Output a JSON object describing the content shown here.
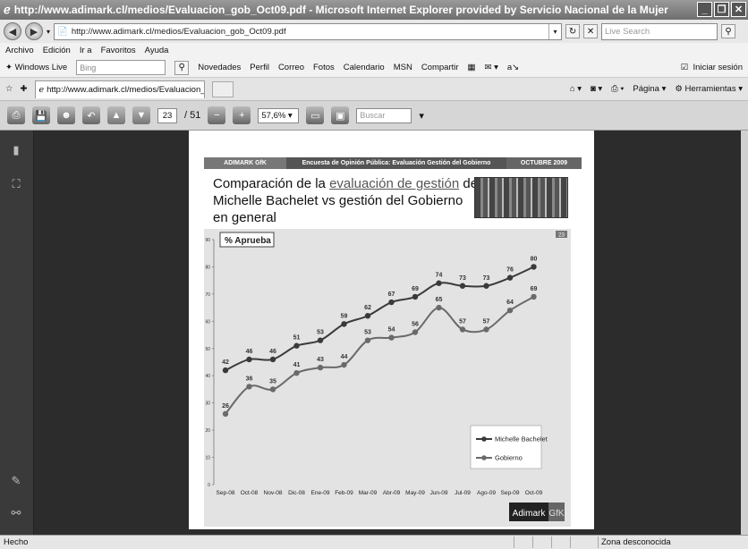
{
  "window": {
    "title": "http://www.adimark.cl/medios/Evaluacion_gob_Oct09.pdf - Microsoft Internet Explorer provided by Servicio Nacional de la Mujer"
  },
  "address": {
    "url": "http://www.adimark.cl/medios/Evaluacion_gob_Oct09.pdf",
    "search_placeholder": "Live Search"
  },
  "menu": [
    "Archivo",
    "Edición",
    "Ir a",
    "Favoritos",
    "Ayuda"
  ],
  "links_bar": {
    "windows_live": "Windows Live",
    "bing_placeholder": "Bing",
    "items": [
      "Novedades",
      "Perfil",
      "Correo",
      "Fotos",
      "Calendario",
      "MSN",
      "Compartir"
    ],
    "signin": "Iniciar sesión"
  },
  "tab": {
    "title": "http://www.adimark.cl/medios/Evaluacion_gob_Oct09...",
    "tools": [
      "Página",
      "Herramientas"
    ]
  },
  "pdf_toolbar": {
    "current_page": "23",
    "total_pages": "/ 51",
    "zoom": "57,6%",
    "search_placeholder": "Buscar"
  },
  "slide": {
    "banner_left": "ADIMARK GfK",
    "banner_center": "Encuesta de Opinión Pública: Evaluación Gestión del Gobierno",
    "banner_right": "OCTUBRE 2009",
    "title_part1": "Comparación de la ",
    "title_highlight": "evaluación de gestión",
    "title_part2": " de",
    "title_line2": "Michelle Bachelet vs gestión del Gobierno en general",
    "page_badge": "23",
    "logo_a": "Adimark",
    "logo_b": "GfK"
  },
  "chart_data": {
    "type": "line",
    "title": "% Aprueba",
    "categories": [
      "Sep-08",
      "Oct-08",
      "Nov-08",
      "Dic-08",
      "Ene-09",
      "Feb-09",
      "Mar-09",
      "Abr-09",
      "May-09",
      "Jun-09",
      "Jul-09",
      "Ago-09",
      "Sep-09",
      "Oct-09"
    ],
    "series": [
      {
        "name": "Michelle Bachelet",
        "values": [
          42,
          46,
          46,
          51,
          53,
          59,
          62,
          67,
          69,
          74,
          73,
          73,
          76,
          80
        ],
        "color": "#3a3a3a"
      },
      {
        "name": "Gobierno",
        "values": [
          26,
          36,
          35,
          41,
          43,
          44,
          53,
          54,
          56,
          65,
          57,
          57,
          64,
          69
        ],
        "color": "#6a6a6a"
      }
    ],
    "yticks": [
      0,
      10,
      20,
      30,
      40,
      50,
      60,
      70,
      80,
      90
    ],
    "ylim": [
      0,
      90
    ],
    "legend": "right",
    "grid": false
  },
  "status": {
    "left": "Hecho",
    "zone": "Zona desconocida"
  }
}
